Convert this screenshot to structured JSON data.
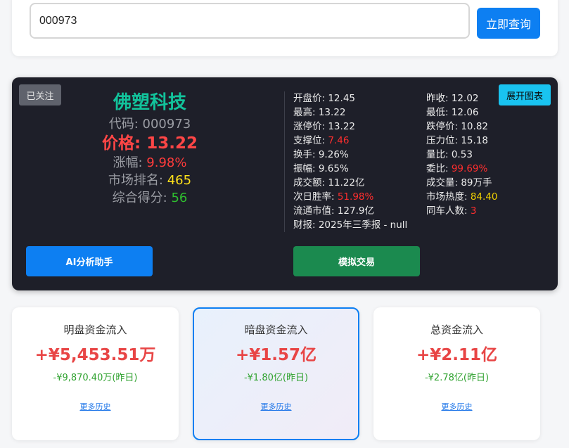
{
  "search": {
    "value": "000973",
    "button_label": "立即查询"
  },
  "stock": {
    "follow_badge": "已关注",
    "chart_button": "展开图表",
    "name": "佛塑科技",
    "code_label": "代码: ",
    "code": "000973",
    "price_label": "价格: ",
    "price": "13.22",
    "change_label": "涨幅: ",
    "change": "9.98%",
    "rank_label": "市场排名: ",
    "rank": "465",
    "score_label": "综合得分: ",
    "score": "56",
    "info_left": [
      {
        "label": "开盘价: ",
        "value": "12.45"
      },
      {
        "label": "最高: ",
        "value": "13.22"
      },
      {
        "label": "涨停价: ",
        "value": "13.22"
      },
      {
        "label": "支撑位: ",
        "value": "7.46"
      },
      {
        "label": "换手: ",
        "value": "9.26%"
      },
      {
        "label": "振幅: ",
        "value": "9.65%"
      },
      {
        "label": "成交额: ",
        "value": "11.22亿"
      },
      {
        "label": "次日胜率: ",
        "value": "51.98%"
      },
      {
        "label": "流通市值: ",
        "value": "127.9亿"
      },
      {
        "label": "财报: ",
        "value": "2025年三季报 - null"
      }
    ],
    "info_right": [
      {
        "label": "昨收: ",
        "value": "12.02"
      },
      {
        "label": "最低: ",
        "value": "12.06"
      },
      {
        "label": "跌停价: ",
        "value": "10.82"
      },
      {
        "label": "压力位: ",
        "value": "15.18"
      },
      {
        "label": "量比: ",
        "value": "0.53"
      },
      {
        "label": "委比: ",
        "value": "99.69%"
      },
      {
        "label": "成交量: ",
        "value": "89万手"
      },
      {
        "label": "市场热度: ",
        "value": "84.40"
      },
      {
        "label": "同车人数: ",
        "value": "3"
      }
    ],
    "ai_button": "AI分析助手",
    "sim_button": "模拟交易"
  },
  "flows": [
    {
      "title": "明盘资金流入",
      "amount": "+¥5,453.51万",
      "previous": "-¥9,870.40万(昨日)",
      "link": "更多历史"
    },
    {
      "title": "暗盘资金流入",
      "amount": "+¥1.57亿",
      "previous": "-¥1.80亿(昨日)",
      "link": "更多历史"
    },
    {
      "title": "总资金流入",
      "amount": "+¥2.11亿",
      "previous": "-¥2.78亿(昨日)",
      "link": "更多历史"
    }
  ],
  "colors": {
    "accent": "#0d7ff2",
    "up": "#e84545",
    "down": "#2fa22f",
    "card_dark": "#1e1f29"
  }
}
